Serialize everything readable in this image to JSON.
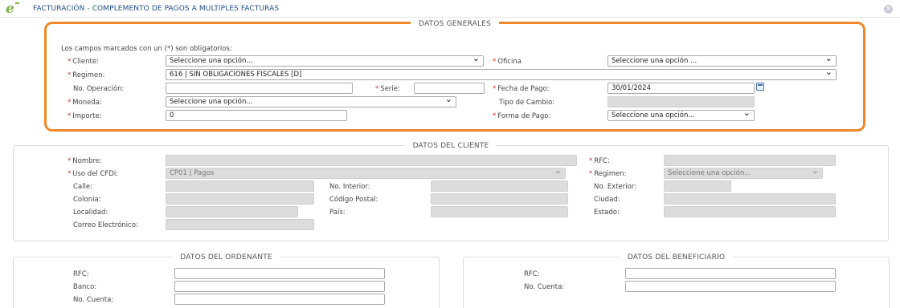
{
  "header": {
    "title": "FACTURACIÓN - COMPLEMENTO DE PAGOS A MULTIPLES FACTURAS",
    "logo_text": "e",
    "close_icon": "close-icon"
  },
  "generales": {
    "legend": "DATOS GENERALES",
    "note": "Los campos marcados con un (*) son obligatorios:",
    "cliente": {
      "label": "Cliente:",
      "value": "Seleccione una opción..."
    },
    "oficina": {
      "label": "Oficina",
      "value": "Seleccione una opción ..."
    },
    "regimen": {
      "label": "Regimen:",
      "value": "616 | SIN OBLIGACIONES FISCALES [D]"
    },
    "no_operacion": {
      "label": "No. Operación:",
      "value": ""
    },
    "serie": {
      "label": "Serie:",
      "value": ""
    },
    "fecha_pago": {
      "label": "Fecha de Pago:",
      "value": "30/01/2024"
    },
    "moneda": {
      "label": "Moneda:",
      "value": "Seleccione una opción..."
    },
    "tipo_cambio": {
      "label": "Tipo de Cambio:",
      "value": ""
    },
    "importe": {
      "label": "Importe:",
      "value": "0"
    },
    "forma_pago": {
      "label": "Forma de Pago:",
      "value": "Seleccione una opción..."
    }
  },
  "cliente": {
    "legend": "DATOS DEL CLIENTE",
    "nombre": "Nombre:",
    "rfc": "RFC:",
    "uso_cfdi": {
      "label": "Uso del CFDi:",
      "value": "CP01 | Pagos"
    },
    "regimen": {
      "label": "Regimen:",
      "value": "Seleccione una opción..."
    },
    "calle": "Calle:",
    "no_interior": "No. Interior:",
    "no_exterior": "No. Exterior:",
    "colonia": "Colonia:",
    "codigo_postal": "Código Postal:",
    "ciudad": "Ciudad:",
    "localidad": "Localidad:",
    "pais": "País:",
    "estado": "Estado:",
    "correo": "Correo Electrónico:"
  },
  "ordenante": {
    "legend": "DATOS DEL ORDENANTE",
    "rfc": "RFC:",
    "banco": "Banco:",
    "no_cuenta": "No. Cuenta:"
  },
  "beneficiario": {
    "legend": "DATOS DEL BENEFICIARIO",
    "rfc": "RFC:",
    "no_cuenta": "No. Cuenta:"
  },
  "colors": {
    "accent_border": "#f0882a",
    "title_blue": "#1f4e8c",
    "required": "#d32f2f",
    "logo_green": "#7cb342"
  }
}
